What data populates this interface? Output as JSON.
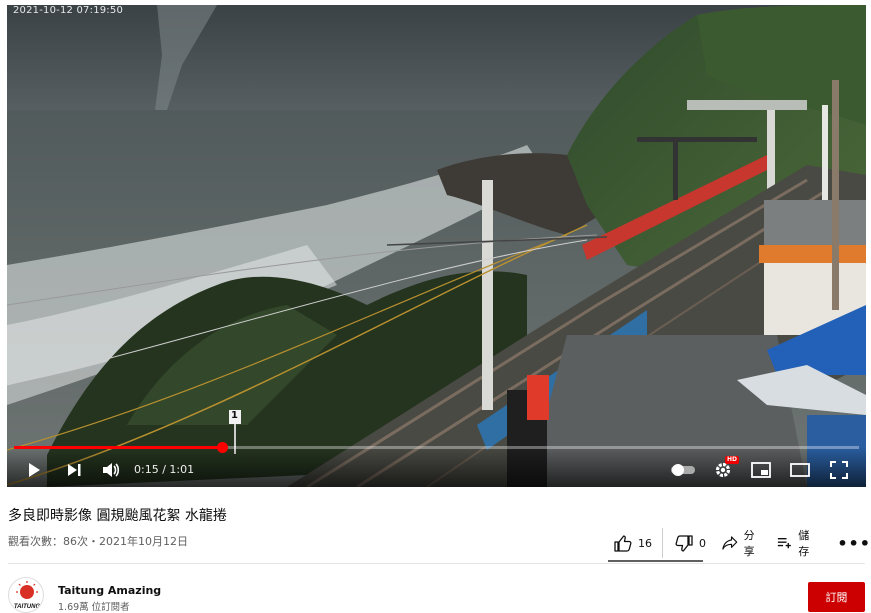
{
  "player": {
    "timestamp_overlay": "2021-10-12 07:19:50",
    "time_display": "0:15 / 1:01",
    "progress": 0.246,
    "hd_badge": "HD",
    "sign_number": "1"
  },
  "video": {
    "title": "多良即時影像 圓規颱風花絮 水龍捲",
    "meta": "觀看次數：86次・2021年10月12日"
  },
  "actions": {
    "like_count": "16",
    "dislike_count": "0",
    "share_label": "分享",
    "save_label": "儲存",
    "more_label": "•••"
  },
  "channel": {
    "name": "Taitung Amazing",
    "subscribers": "1.69萬 位訂閱者",
    "avatar_text": "TAITUNG",
    "subscribe_label": "訂閱"
  },
  "colors": {
    "accent": "#ff0000",
    "subscribe": "#cc0000"
  }
}
